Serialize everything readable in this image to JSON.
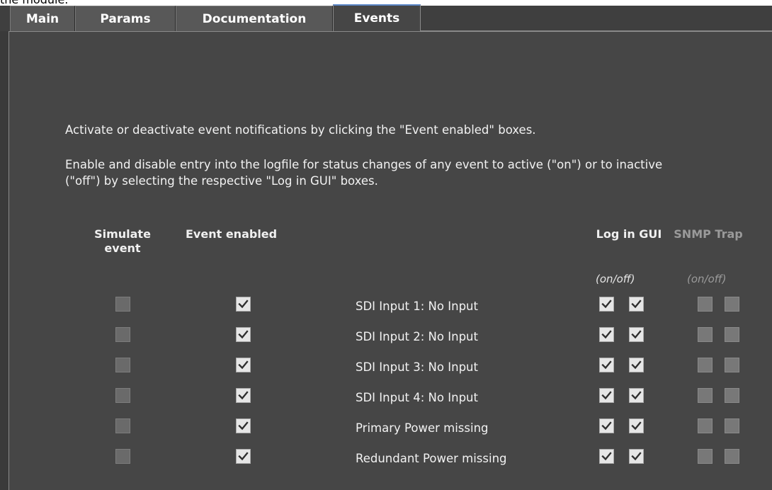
{
  "top_text": "the module.",
  "tabs": [
    {
      "label": "Main",
      "active": false
    },
    {
      "label": "Params",
      "active": false
    },
    {
      "label": "Documentation",
      "active": false
    },
    {
      "label": "Events",
      "active": true
    }
  ],
  "description": {
    "line1": "Activate or deactivate event notifications by clicking the \"Event enabled\" boxes.",
    "line2a": "Enable and disable entry into the logfile for status changes of any event to active (\"on\") or to inactive",
    "line2b": "(\"off\") by selecting the respective \"Log in GUI\" boxes."
  },
  "headers": {
    "simulate_line1": "Simulate",
    "simulate_line2": "event",
    "event_enabled": "Event enabled",
    "log_in_gui": "Log in GUI",
    "snmp_trap": "SNMP Trap",
    "log_sub": "(on/off)",
    "snmp_sub": "(on/off)"
  },
  "events": [
    {
      "label": "SDI Input 1: No Input",
      "simulate": false,
      "enabled": true,
      "log_on": true,
      "log_off": true,
      "snmp_on": false,
      "snmp_off": false
    },
    {
      "label": "SDI Input 2: No Input",
      "simulate": false,
      "enabled": true,
      "log_on": true,
      "log_off": true,
      "snmp_on": false,
      "snmp_off": false
    },
    {
      "label": "SDI Input 3: No Input",
      "simulate": false,
      "enabled": true,
      "log_on": true,
      "log_off": true,
      "snmp_on": false,
      "snmp_off": false
    },
    {
      "label": "SDI Input 4: No Input",
      "simulate": false,
      "enabled": true,
      "log_on": true,
      "log_off": true,
      "snmp_on": false,
      "snmp_off": false
    },
    {
      "label": "Primary Power missing",
      "simulate": false,
      "enabled": true,
      "log_on": true,
      "log_off": true,
      "snmp_on": false,
      "snmp_off": false
    },
    {
      "label": "Redundant Power missing",
      "simulate": false,
      "enabled": true,
      "log_on": true,
      "log_off": true,
      "snmp_on": false,
      "snmp_off": false
    }
  ],
  "colors": {
    "panel_bg": "#464646",
    "active_tab_accent": "#5b87c7",
    "snmp_header": "#9a9a9a"
  }
}
